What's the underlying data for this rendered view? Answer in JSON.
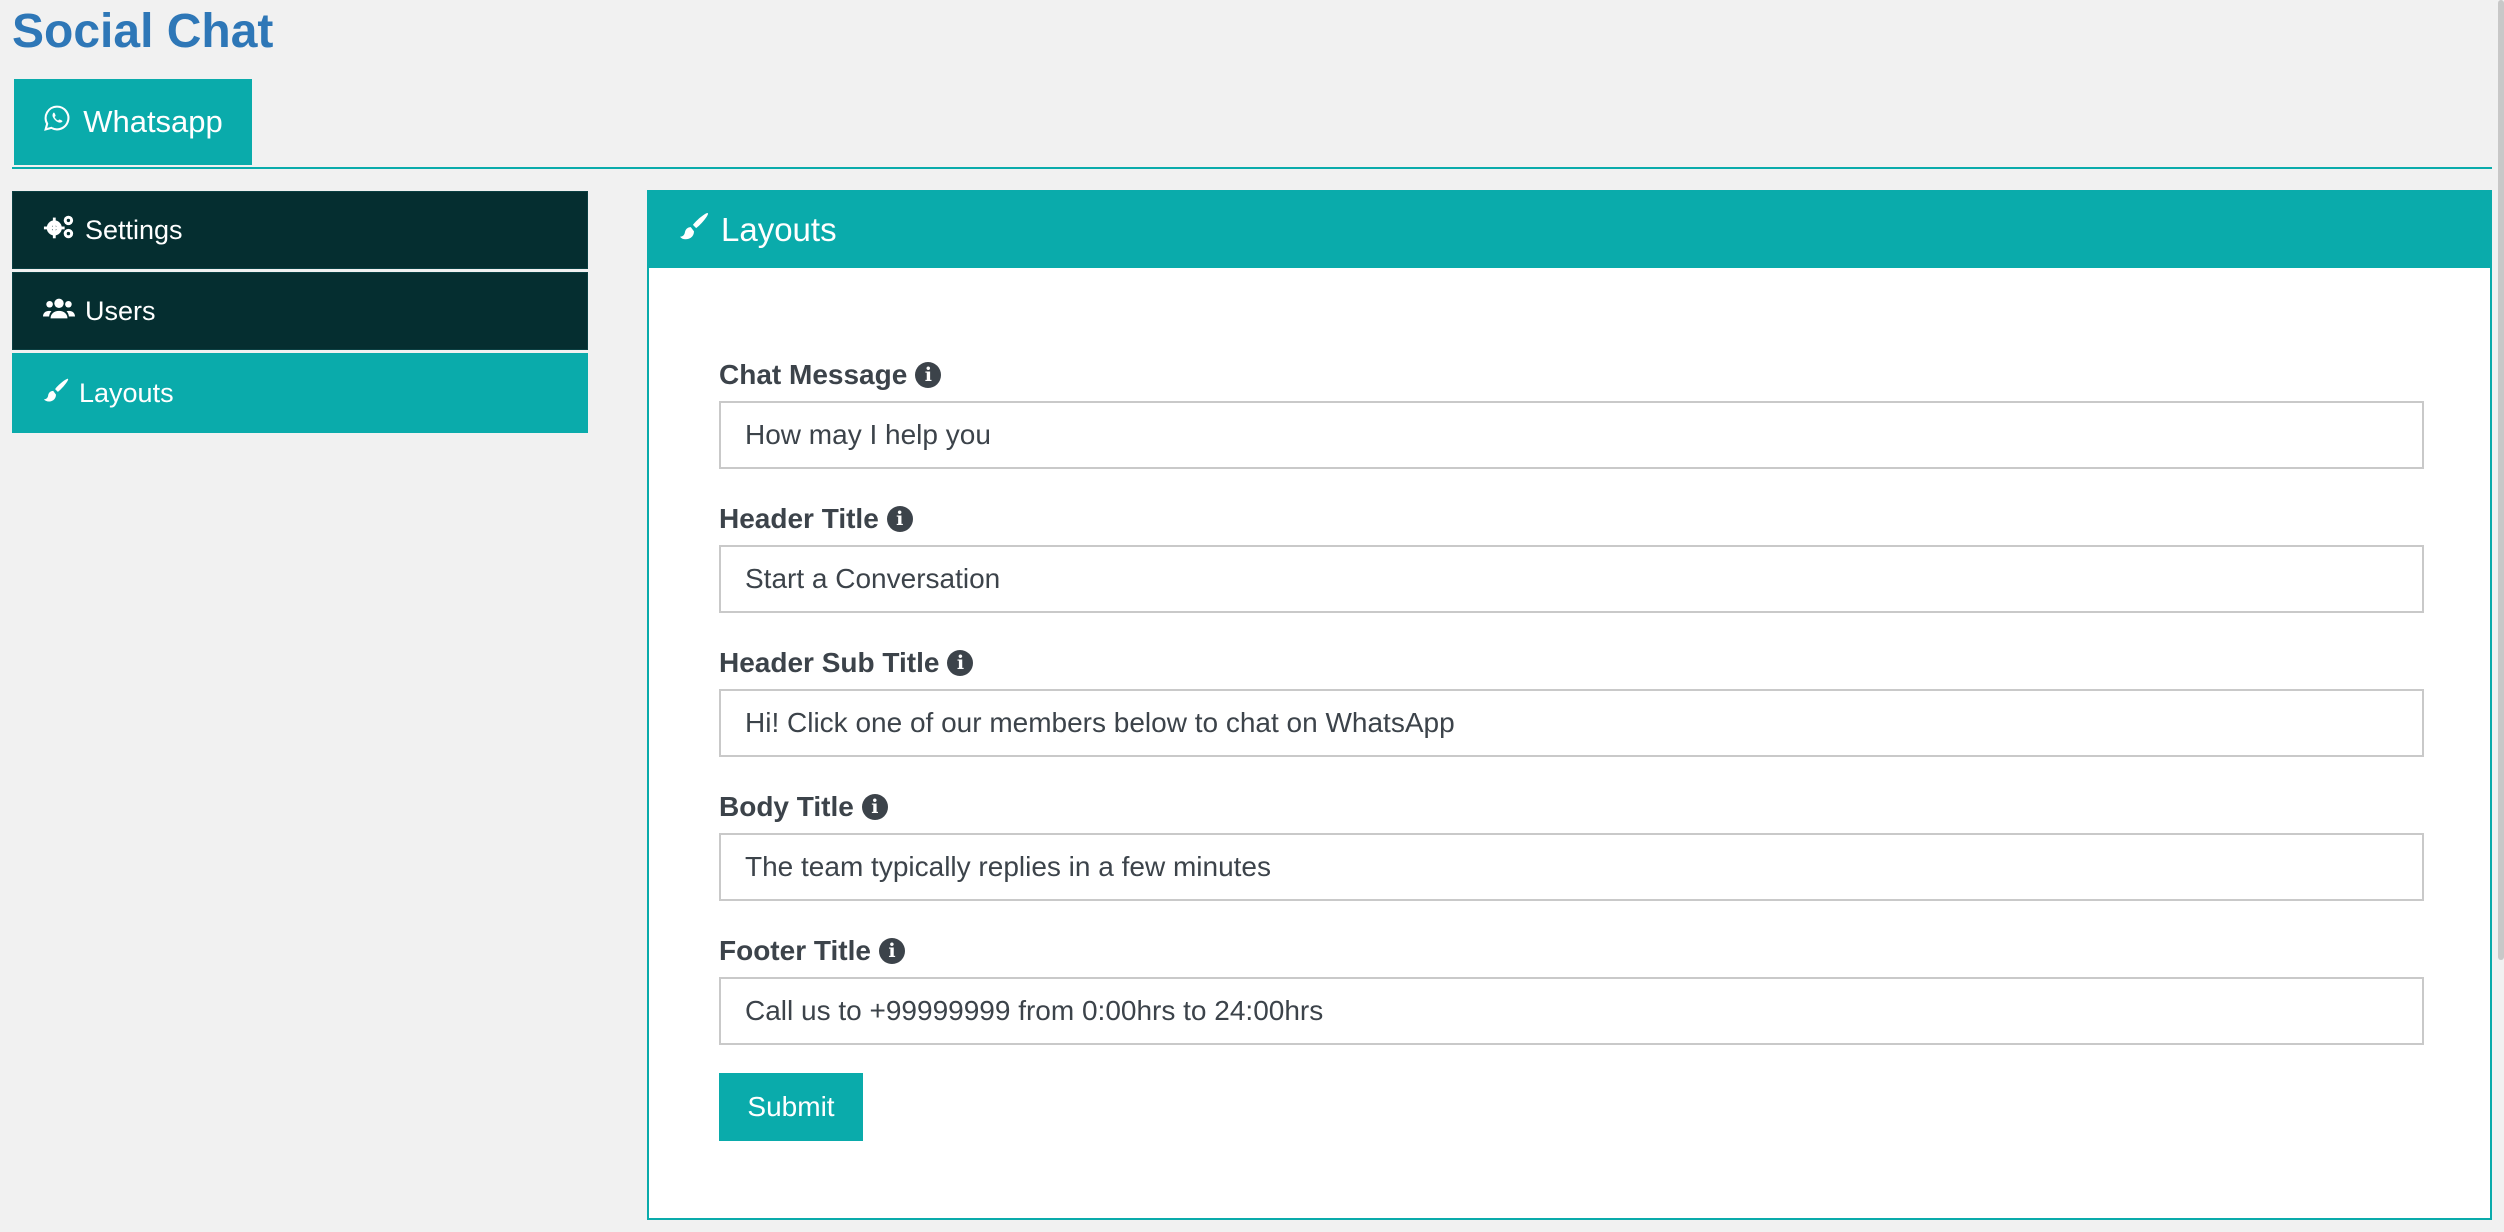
{
  "app": {
    "title": "Social Chat"
  },
  "top_tab": {
    "label": "Whatsapp",
    "icon": "whatsapp-icon"
  },
  "sidebar": {
    "items": [
      {
        "label": "Settings",
        "icon": "gears-icon",
        "active": false
      },
      {
        "label": "Users",
        "icon": "users-icon",
        "active": false
      },
      {
        "label": "Layouts",
        "icon": "brush-icon",
        "active": true
      }
    ]
  },
  "panel": {
    "title": "Layouts",
    "icon": "brush-icon",
    "fields": [
      {
        "label": "Chat Message",
        "value": "How may I help you"
      },
      {
        "label": "Header Title",
        "value": "Start a Conversation"
      },
      {
        "label": "Header Sub Title",
        "value": "Hi! Click one of our members below to chat on WhatsApp"
      },
      {
        "label": "Body Title",
        "value": "The team typically replies in a few minutes"
      },
      {
        "label": "Footer Title",
        "value": "Call us to +99999999 from 0:00hrs to 24:00hrs"
      }
    ],
    "submit_label": "Submit"
  },
  "colors": {
    "accent": "#0aabab",
    "title": "#2e77b7",
    "sidebar_dark": "#052e30"
  }
}
